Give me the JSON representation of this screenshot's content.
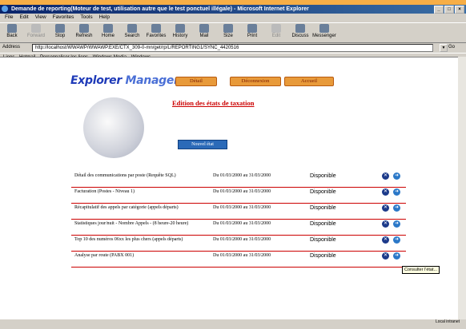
{
  "window": {
    "title": "Demande de reporting(Moteur de test, utilisation autre que le test ponctuel illégale) - Microsoft Internet Explorer",
    "controls": [
      "_",
      "□",
      "×"
    ]
  },
  "menu": [
    "File",
    "Edit",
    "View",
    "Favorites",
    "Tools",
    "Help"
  ],
  "toolbar": [
    {
      "label": "Back",
      "icon": "back-arrow-icon",
      "disabled": false
    },
    {
      "label": "Forward",
      "icon": "forward-arrow-icon",
      "disabled": true
    },
    {
      "label": "Stop",
      "icon": "stop-icon",
      "disabled": false
    },
    {
      "label": "Refresh",
      "icon": "refresh-icon",
      "disabled": false
    },
    {
      "label": "Home",
      "icon": "home-icon",
      "disabled": false
    },
    {
      "label": "Search",
      "icon": "search-icon",
      "disabled": false
    },
    {
      "label": "Favorites",
      "icon": "favorites-icon",
      "disabled": false
    },
    {
      "label": "History",
      "icon": "history-icon",
      "disabled": false
    },
    {
      "label": "Mail",
      "icon": "mail-icon",
      "disabled": false
    },
    {
      "label": "Size",
      "icon": "size-icon",
      "disabled": false
    },
    {
      "label": "Print",
      "icon": "print-icon",
      "disabled": false
    },
    {
      "label": "Edit",
      "icon": "edit-icon",
      "disabled": true
    },
    {
      "label": "Discuss",
      "icon": "discuss-icon",
      "disabled": false
    },
    {
      "label": "Messenger",
      "icon": "messenger-icon",
      "disabled": false
    }
  ],
  "address": {
    "label": "Address",
    "url": "http://localhost/WWAWP/WWAWP.EXE/CTX_309-0-mn/get/rp/L/REPORTING1/SYNC_4420516",
    "go": "Go"
  },
  "links": {
    "label": "Liens",
    "items": [
      "Hotmail",
      "Personnaliser les liens",
      "Windows Media",
      "Windows"
    ]
  },
  "page": {
    "logo_part1": "Explorer",
    "logo_part2": "Manager",
    "nav": [
      "Détail",
      "Déconnexion",
      "Accueil"
    ],
    "title": "Edition des états de taxation",
    "new_button": "Nouvel état",
    "tooltip": "Consulter l'état..."
  },
  "reports": [
    {
      "label": "Détail des communications par poste (Requête SQL)",
      "period": "Du 01/03/2000 au 31/03/2000",
      "status": "Disponible"
    },
    {
      "label": "Facturation (Postes - Niveau 1)",
      "period": "Du 01/03/2000 au 31/03/2000",
      "status": "Disponible"
    },
    {
      "label": "Récapitulatif des appels par catégorie (appels départs)",
      "period": "Du 01/03/2000 au 31/03/2000",
      "status": "Disponible"
    },
    {
      "label": "Statistiques jour/nuit - Nombre Appels - (8 heure-20 heure)",
      "period": "Du 01/03/2000 au 31/03/2000",
      "status": "Disponible"
    },
    {
      "label": "Top 10 des numéros 06xx les plus chers (appels départs)",
      "period": "Du 01/03/2000 au 31/03/2000",
      "status": "Disponible"
    },
    {
      "label": "Analyse par route (PABX 001)",
      "period": "Du 01/03/2000 au 31/03/2000",
      "status": "Disponible"
    }
  ],
  "statusbar": {
    "zone": "Local intranet"
  },
  "colors": {
    "accent_red": "#cc0000",
    "title_bar": "#0a246a",
    "logo_blue": "#1e3ab8",
    "nav_orange": "#e89a3a"
  }
}
